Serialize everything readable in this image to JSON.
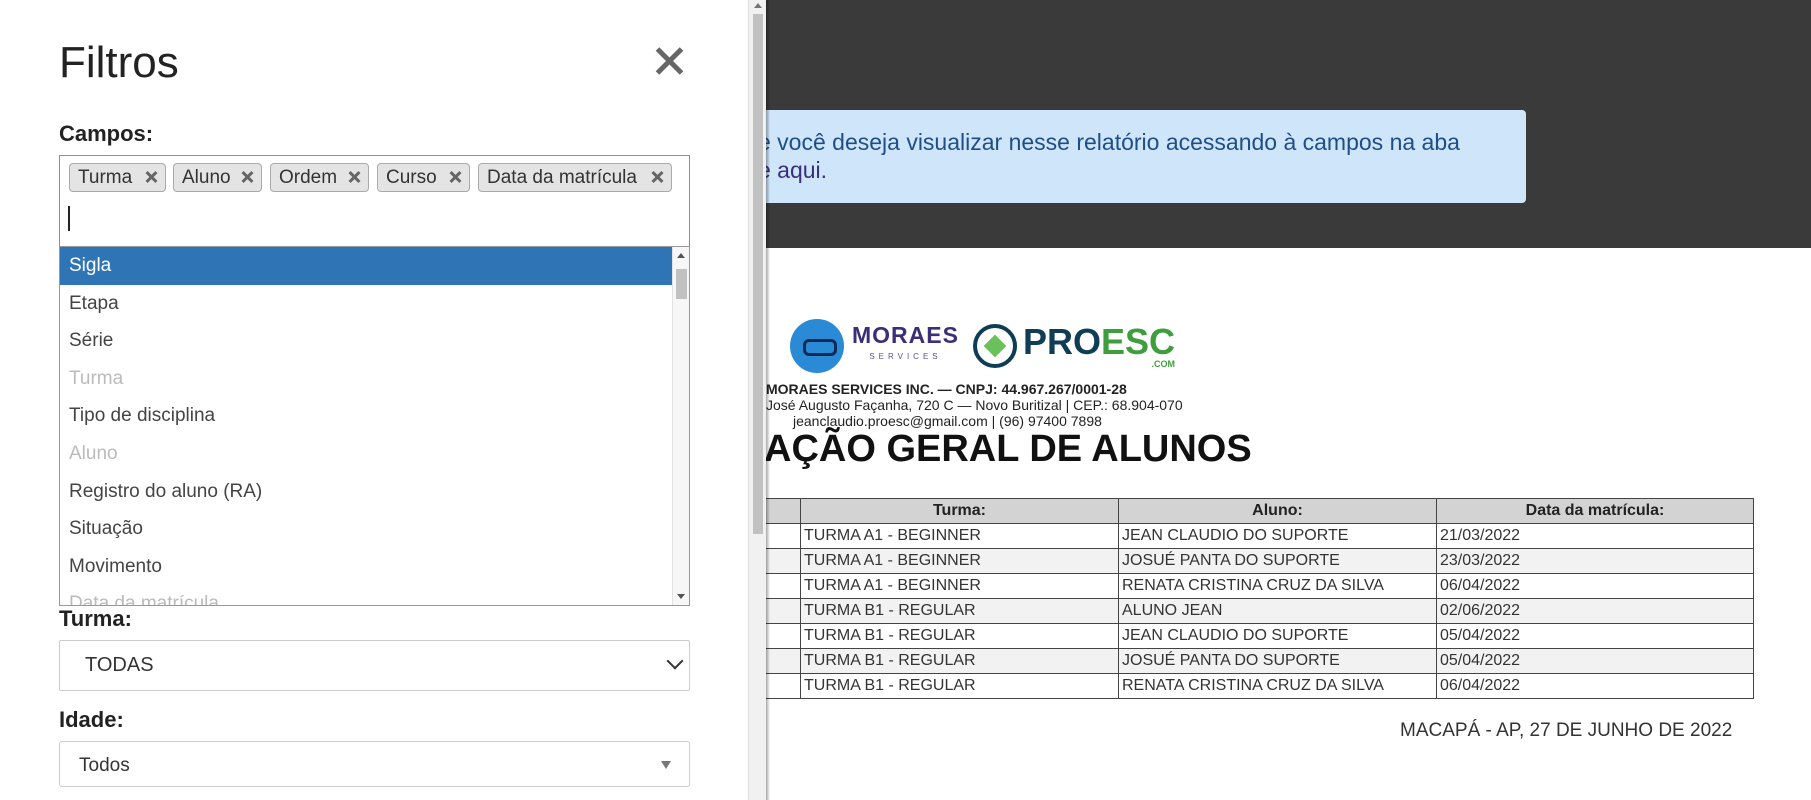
{
  "panel": {
    "title": "Filtros",
    "campos_label": "Campos:",
    "selected_tags": [
      "Turma",
      "Aluno",
      "Ordem",
      "Curso",
      "Data da matrícula"
    ],
    "options": [
      {
        "label": "Sigla",
        "state": "highlighted"
      },
      {
        "label": "Etapa",
        "state": "normal"
      },
      {
        "label": "Série",
        "state": "normal"
      },
      {
        "label": "Turma",
        "state": "disabled"
      },
      {
        "label": "Tipo de disciplina",
        "state": "normal"
      },
      {
        "label": "Aluno",
        "state": "disabled"
      },
      {
        "label": "Registro do aluno (RA)",
        "state": "normal"
      },
      {
        "label": "Situação",
        "state": "normal"
      },
      {
        "label": "Movimento",
        "state": "normal"
      },
      {
        "label": "Data da matrícula",
        "state": "disabled"
      }
    ],
    "turma_label": "Turma:",
    "turma_value": "TODAS",
    "idade_label": "Idade:",
    "idade_value": "Todos"
  },
  "alert": {
    "line1": "e você deseja visualizar nesse relatório acessando à campos na aba",
    "line2": "e aqui."
  },
  "logos": {
    "moraes": "MORAES",
    "moraes_sub": "SERVICES",
    "proesc_pro": "PRO",
    "proesc_esc": "ESC",
    "proesc_com": ".COM"
  },
  "report": {
    "company_name": "MORAES SERVICES INC. — CNPJ: 44.967.267/0001-28",
    "company_address": "José Augusto Façanha, 720 C — Novo Buritizal | CEP.: 68.904-070",
    "company_contact": "jeanclaudio.proesc@gmail.com | (96) 97400 7898",
    "title": "AÇÃO GERAL DE ALUNOS",
    "columns": [
      "",
      "Turma:",
      "Aluno:",
      "Data da matrícula:"
    ],
    "rows": [
      [
        "",
        "TURMA A1 - BEGINNER",
        "JEAN CLAUDIO DO SUPORTE",
        "21/03/2022"
      ],
      [
        "",
        "TURMA A1 - BEGINNER",
        "JOSUÉ PANTA DO SUPORTE",
        "23/03/2022"
      ],
      [
        "",
        "TURMA A1 - BEGINNER",
        "RENATA CRISTINA CRUZ DA SILVA",
        "06/04/2022"
      ],
      [
        "",
        "TURMA B1 - REGULAR",
        "ALUNO JEAN",
        "02/06/2022"
      ],
      [
        "",
        "TURMA B1 - REGULAR",
        "JEAN CLAUDIO DO SUPORTE",
        "05/04/2022"
      ],
      [
        "",
        "TURMA B1 - REGULAR",
        "JOSUÉ PANTA DO SUPORTE",
        "05/04/2022"
      ],
      [
        "",
        "TURMA B1 - REGULAR",
        "RENATA CRISTINA CRUZ DA SILVA",
        "06/04/2022"
      ]
    ],
    "date_line": "MACAPÁ - AP, 27 DE JUNHO DE 2022"
  },
  "colors": {
    "highlight": "#2f74b5",
    "alert_bg": "#cfe5fa",
    "overlay": "#3a3a3a"
  }
}
